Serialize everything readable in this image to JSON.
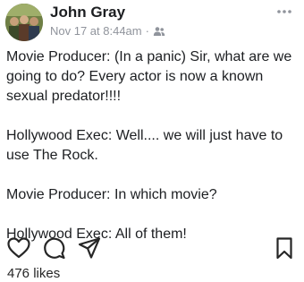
{
  "post": {
    "author": "John Gray",
    "timestamp": "Nov 17 at 8:44am",
    "separator": "·",
    "privacy_icon": "friends-icon",
    "more_icon": "more-horizontal-icon",
    "paragraphs": [
      "Movie Producer: (In a panic) Sir, what are we going to do? Every actor is now a known sexual predator!!!!",
      "Hollywood Exec: Well.... we will just have to use The Rock.",
      "Movie Producer: In which movie?",
      "Hollywood Exec: All of them!"
    ]
  },
  "actions": {
    "like_icon": "heart-icon",
    "comment_icon": "comment-icon",
    "share_icon": "send-icon",
    "save_icon": "bookmark-icon"
  },
  "likes": {
    "label": "476 likes"
  },
  "colors": {
    "text": "#1c1e21",
    "meta": "#90949c",
    "icon": "#262626"
  }
}
